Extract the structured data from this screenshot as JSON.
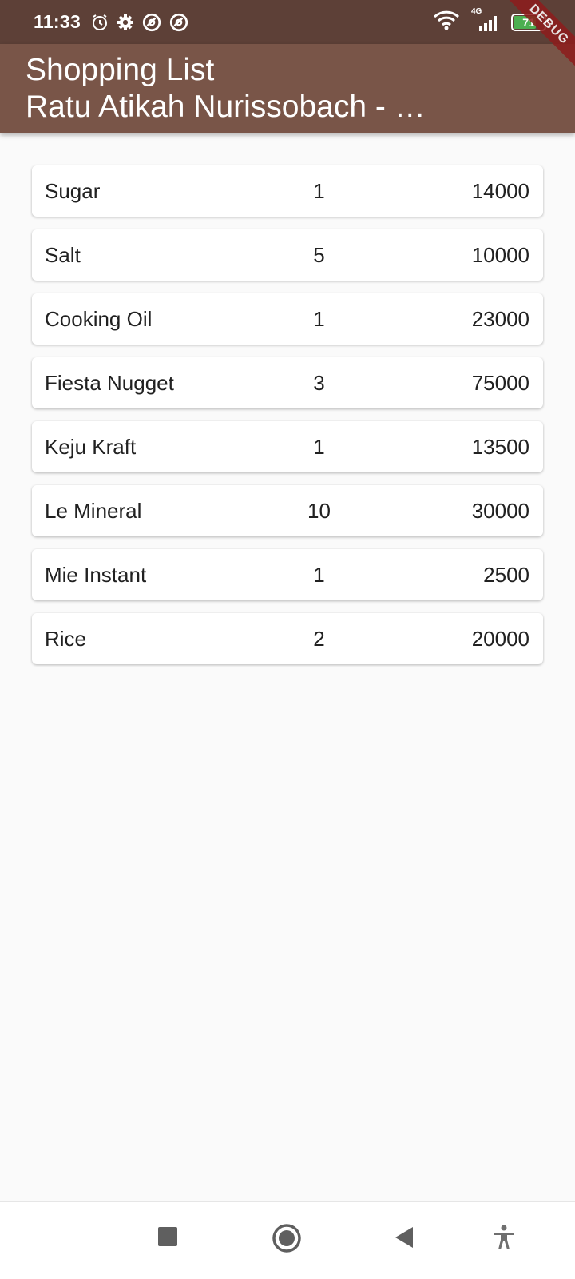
{
  "status_bar": {
    "time": "11:33",
    "battery_level": "71",
    "network": "4G"
  },
  "debug_banner": "DEBUG",
  "app_bar": {
    "title": "Shopping List",
    "subtitle": "Ratu Atikah Nurissobach - …"
  },
  "items": [
    {
      "name": "Sugar",
      "qty": "1",
      "price": "14000"
    },
    {
      "name": "Salt",
      "qty": "5",
      "price": "10000"
    },
    {
      "name": "Cooking Oil",
      "qty": "1",
      "price": "23000"
    },
    {
      "name": "Fiesta Nugget",
      "qty": "3",
      "price": "75000"
    },
    {
      "name": "Keju Kraft",
      "qty": "1",
      "price": "13500"
    },
    {
      "name": "Le Mineral",
      "qty": "10",
      "price": "30000"
    },
    {
      "name": "Mie Instant",
      "qty": "1",
      "price": "2500"
    },
    {
      "name": "Rice",
      "qty": "2",
      "price": "20000"
    }
  ],
  "nav": {
    "icons": [
      "recents-square-icon",
      "home-circle-icon",
      "back-triangle-icon",
      "accessibility-icon"
    ]
  },
  "colors": {
    "status_bar": "#5d4037",
    "app_bar": "#795548",
    "background": "#fafafa",
    "battery": "#4caf50",
    "debug": "#8e1c1c"
  }
}
